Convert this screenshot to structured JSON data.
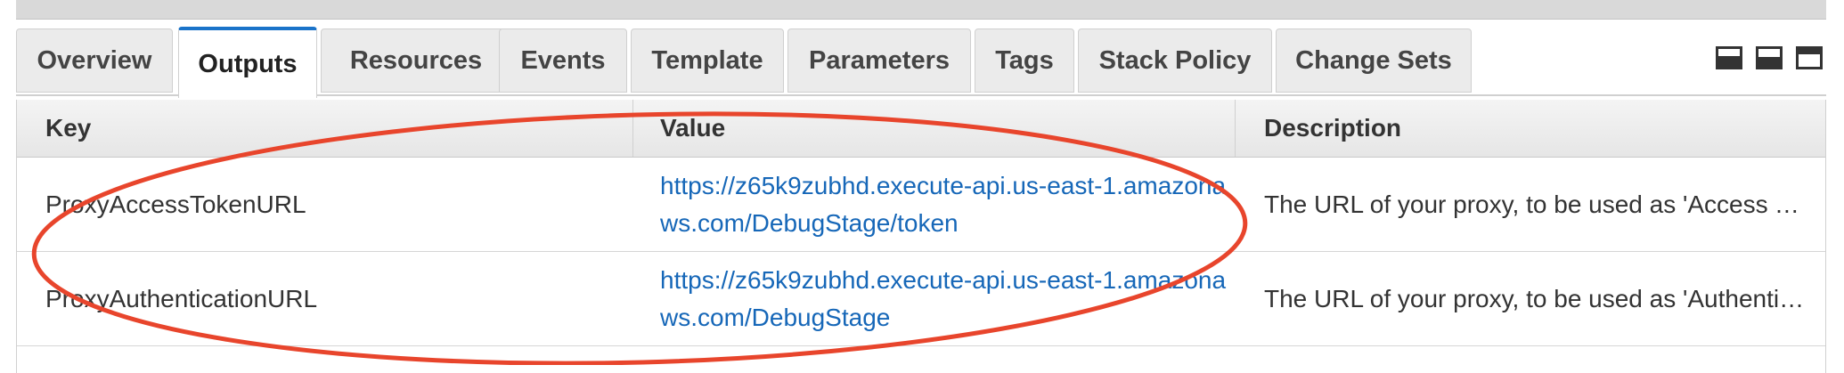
{
  "tabs": [
    {
      "label": "Overview",
      "active": false
    },
    {
      "label": "Outputs",
      "active": true
    },
    {
      "label": "Resources",
      "active": false
    },
    {
      "label": "Events",
      "active": false
    },
    {
      "label": "Template",
      "active": false
    },
    {
      "label": "Parameters",
      "active": false
    },
    {
      "label": "Tags",
      "active": false
    },
    {
      "label": "Stack Policy",
      "active": false
    },
    {
      "label": "Change Sets",
      "active": false
    }
  ],
  "layout_icons": [
    "panel-bottom-large-icon",
    "panel-split-icon",
    "panel-top-icon"
  ],
  "table": {
    "headers": {
      "key": "Key",
      "value": "Value",
      "description": "Description"
    },
    "rows": [
      {
        "key": "ProxyAccessTokenURL",
        "value": "https://z65k9zubhd.execute-api.us-east-1.amazonaws.com/DebugStage/token",
        "description": "The URL of your proxy, to be used as 'Access Token URL' …"
      },
      {
        "key": "ProxyAuthenticationURL",
        "value": "https://z65k9zubhd.execute-api.us-east-1.amazonaws.com/DebugStage",
        "description": "The URL of your proxy, to be used as 'Authentication URL' …"
      }
    ]
  },
  "colors": {
    "active_tab_border": "#1a73c9",
    "link": "#1667b8",
    "annotation_ellipse": "#e8452c"
  }
}
